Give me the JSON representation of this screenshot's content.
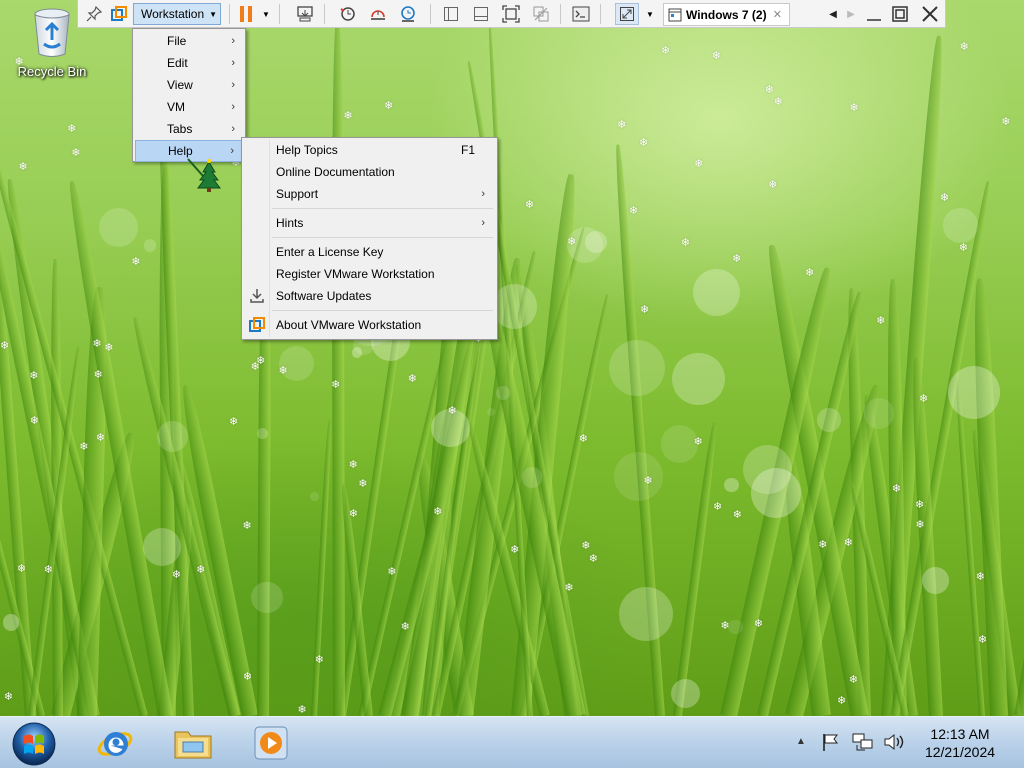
{
  "desktop": {
    "recycle_bin_label": "Recycle Bin"
  },
  "toolbar": {
    "workstation_label": "Workstation",
    "vm_tab_label": "Windows 7 (2)",
    "vm_tab_close": "✕",
    "icons": [
      "pin-icon",
      "vmware-logo-icon",
      "pause-icon",
      "dropdown-arrow-icon",
      "send-ctrl-alt-del-icon",
      "snapshot-take-icon",
      "snapshot-revert-icon",
      "snapshot-manager-icon",
      "show-library-icon",
      "thumbnail-bar-icon",
      "full-screen-icon",
      "unity-icon",
      "console-view-icon",
      "stretch-guest-icon",
      "tab-scroll-left-icon",
      "tab-scroll-right-icon",
      "minimize-icon",
      "restore-icon",
      "close-icon"
    ]
  },
  "main_menu": {
    "items": [
      {
        "label": "File",
        "arrow": "›"
      },
      {
        "label": "Edit",
        "arrow": "›"
      },
      {
        "label": "View",
        "arrow": "›"
      },
      {
        "label": "VM",
        "arrow": "›"
      },
      {
        "label": "Tabs",
        "arrow": "›"
      },
      {
        "label": "Help",
        "arrow": "›"
      }
    ],
    "active_item": "Help"
  },
  "help_menu": {
    "items": [
      {
        "label": "Help Topics",
        "accelerator": "F1"
      },
      {
        "label": "Online Documentation"
      },
      {
        "label": "Support",
        "arrow": "›"
      },
      {
        "label": "Hints",
        "arrow": "›"
      },
      {
        "label": "Enter a License Key"
      },
      {
        "label": "Register VMware Workstation"
      },
      {
        "label": "Software Updates",
        "icon": "download-icon"
      },
      {
        "label": "About VMware Workstation",
        "icon": "vmware-logo-icon"
      }
    ]
  },
  "taskbar": {
    "apps": [
      "start-orb-icon",
      "internet-explorer-icon",
      "windows-explorer-icon",
      "media-player-icon"
    ],
    "tray_icons": [
      "show-hidden-icons-arrow",
      "action-center-flag-icon",
      "network-icon",
      "volume-icon"
    ],
    "clock_time": "12:13 AM",
    "clock_date": "12/21/2024"
  },
  "colors": {
    "menu_highlight": "#b9d6f4",
    "toolbar_button_active": "#cfe3f7",
    "pause_orange": "#f07d1a",
    "vmware_orange": "#f38b00",
    "vmware_blue": "#1d7ac5"
  }
}
